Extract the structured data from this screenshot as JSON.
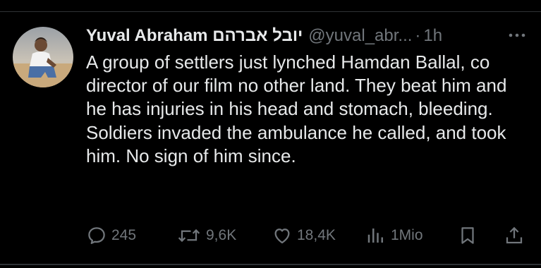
{
  "tweet": {
    "author": {
      "display_name": "Yuval Abraham יובל אברהם",
      "handle": "@yuval_abr...",
      "avatar_icon": "profile-photo-icon"
    },
    "separator": "·",
    "time": "1h",
    "text": "A group of settlers just lynched Hamdan Ballal, co director of our film no other land. They beat him and he has injuries in his head and stomach, bleeding. Soldiers invaded the ambulance he called, and took him. No sign of him since.",
    "actions": {
      "replies": "245",
      "reposts": "9,6K",
      "likes": "18,4K",
      "views": "1Mio"
    }
  },
  "colors": {
    "background": "#000000",
    "text": "#e7e9ea",
    "muted": "#71767b",
    "divider": "#2f3336"
  }
}
